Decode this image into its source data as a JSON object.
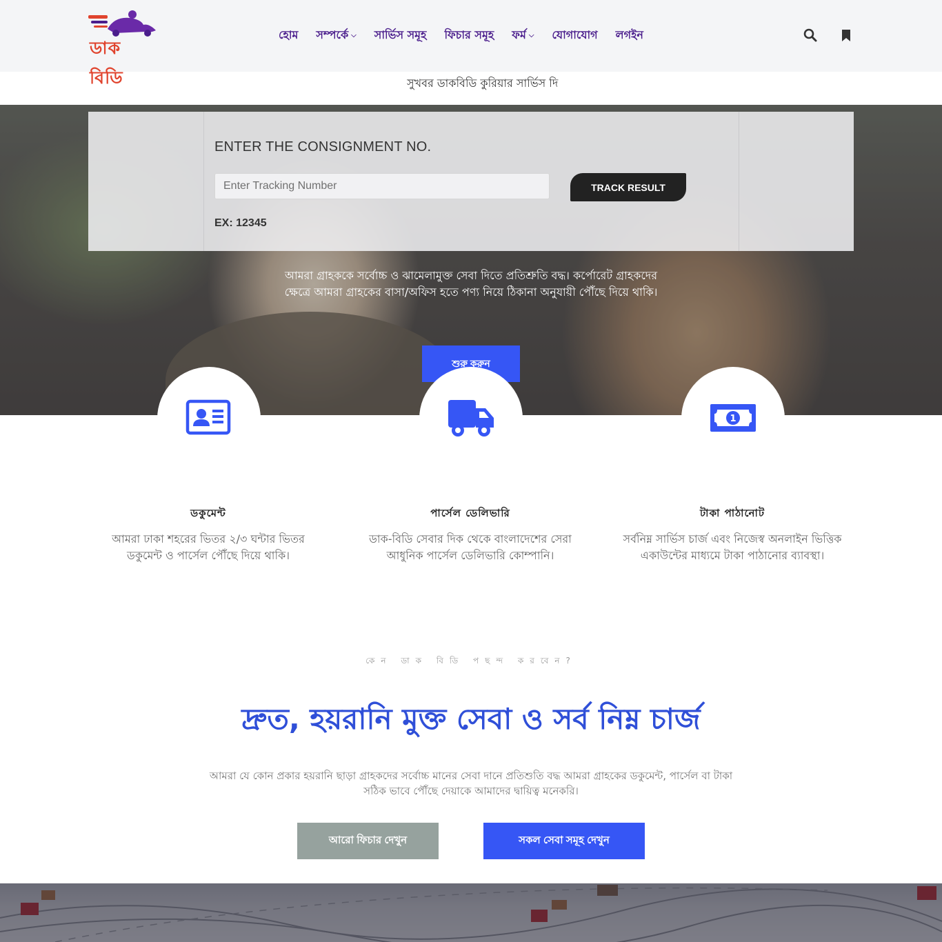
{
  "header": {
    "logo_text": "ডাক বিডি",
    "nav": [
      {
        "label": "হোম",
        "dropdown": false
      },
      {
        "label": "সম্পর্কে",
        "dropdown": true
      },
      {
        "label": "সার্ভিস সমূহ",
        "dropdown": false
      },
      {
        "label": "ফিচার সমূহ",
        "dropdown": false
      },
      {
        "label": "ফর্ম",
        "dropdown": true
      },
      {
        "label": "যোগাযোগ",
        "dropdown": false
      },
      {
        "label": "লগইন",
        "dropdown": false
      }
    ],
    "icons": [
      "search-icon",
      "bookmark-icon"
    ]
  },
  "marquee": {
    "text": "সুখবর ডাকবিডি কুরিয়ার সার্ভিস দি"
  },
  "tracking": {
    "title": "ENTER THE CONSIGNMENT NO.",
    "placeholder": "Enter Tracking Number",
    "value": "",
    "button": "TRACK RESULT",
    "example": "EX: 12345"
  },
  "hero": {
    "text": "আমরা গ্রাহককে সর্বোচ্চ ও ঝামেলামুক্ত সেবা দিতে প্রতিশ্রুতি বদ্ধ। কর্পোরেট গ্রাহকদের ক্ষেত্রে আমরা গ্রাহকের বাসা/অফিস হতে পণ্য নিয়ে ঠিকানা অনুযায়ী পৌঁছে দিয়ে থাকি।",
    "button": "শুরু করুন"
  },
  "features": [
    {
      "icon": "id-card-icon",
      "title": "ডকুমেন্ট",
      "desc": "আমরা ঢাকা শহরের ভিতর ২/৩ ঘন্টার ভিতর ডকুমেন্ট ও পার্সেল পৌঁছে দিয়ে থাকি।"
    },
    {
      "icon": "truck-icon",
      "title": "পার্সেল ডেলিভারি",
      "desc": "ডাক-বিডি সেবার দিক থেকে বাংলাদেশের সেরা আধুনিক পার্সেল ডেলিভারি কোম্পানি।"
    },
    {
      "icon": "money-bill-icon",
      "title": "টাকা পাঠানোট",
      "desc": "সর্বনিম্ন সার্ভিস চার্জ এবং নিজেস্ব অনলাইন ভিত্তিক একাউন্টের মাধ্যমে টাকা পাঠানোর ব্যাবস্থা।"
    }
  ],
  "why": {
    "subtitle": "কেন ডাক বিডি পছন্দ করবেন?",
    "title": "দ্রুত, হয়রানি মুক্ত সেবা ও সর্ব নিম্ন চার্জ",
    "desc": "আমরা যে কোন প্রকার হয়রানি ছাড়া গ্রাহকদের সর্বোচ্চ মানের সেবা দানে প্রতিশুতি বদ্ধ আমরা গ্রাহকের ডকুমেন্ট, পার্সেল বা টাকা সঠিক ভাবে পৌঁছে দেয়াকে আমাদের দ্বায়িত্ব মনেকরি।",
    "btn_features": "আরো ফিচার দেখুন",
    "btn_services": "সকল সেবা সমূহ দেখুন"
  },
  "colors": {
    "brand_purple": "#4a1d8c",
    "accent_blue": "#3656f5",
    "logo_red": "#e0432d",
    "button_gray": "#96a29e"
  }
}
